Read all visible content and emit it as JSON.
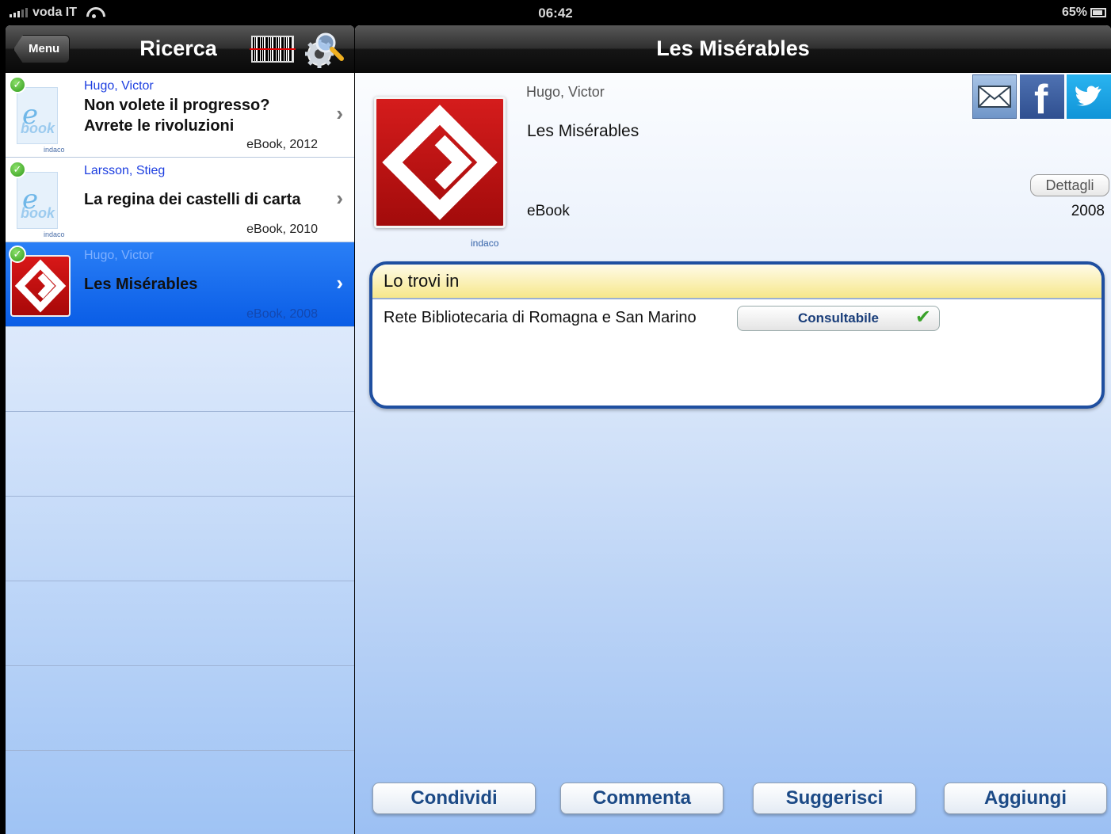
{
  "status_bar": {
    "carrier": "voda IT",
    "time": "06:42",
    "battery": "65%"
  },
  "left_pane": {
    "menu_label": "Menu",
    "title": "Ricerca",
    "results": [
      {
        "author": "Hugo, Victor",
        "title": "Non volete il progresso? Avrete le rivoluzioni",
        "meta": "eBook, 2012",
        "thumb_label_e": "e",
        "thumb_label_book": "book",
        "thumb_brand": "indaco"
      },
      {
        "author": "Larsson, Stieg",
        "title": "La regina dei castelli di carta",
        "meta": "eBook, 2010",
        "thumb_label_e": "e",
        "thumb_label_book": "book",
        "thumb_brand": "indaco"
      },
      {
        "author": "Hugo, Victor",
        "title": "Les Misérables",
        "meta": "eBook, 2008"
      }
    ]
  },
  "detail": {
    "nav_title": "Les Misérables",
    "author": "Hugo, Victor",
    "title": "Les Misérables",
    "format": "eBook",
    "year": "2008",
    "dettagli_label": "Dettagli",
    "cover_brand": "indaco",
    "availability": {
      "header": "Lo trovi in",
      "library": "Rete Bibliotecaria di Romagna e San Marino",
      "status": "Consultabile"
    },
    "actions": [
      "Condividi",
      "Commenta",
      "Suggerisci",
      "Aggiungi"
    ]
  },
  "colors": {
    "selected_row": "#1568ee",
    "box_border": "#1f4fa0",
    "button_text": "#1c4a86"
  }
}
